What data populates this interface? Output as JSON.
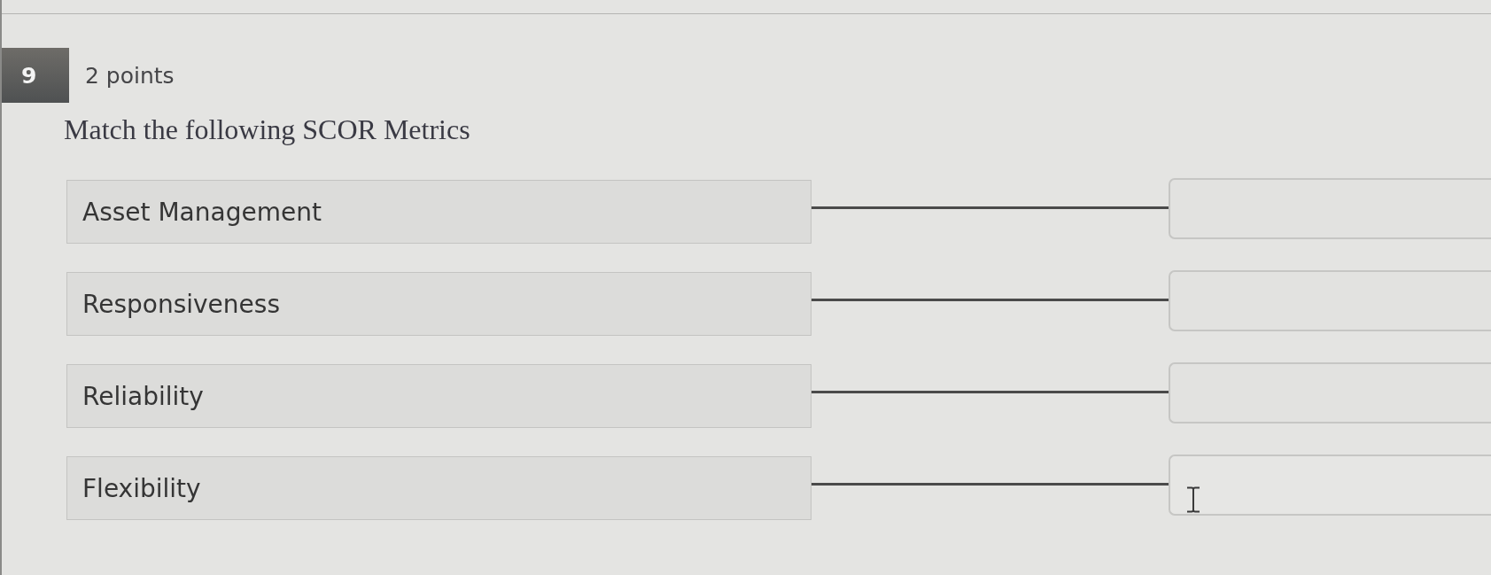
{
  "question": {
    "number": "9",
    "points": "2 points",
    "prompt": "Match the following SCOR Metrics"
  },
  "pairs": [
    {
      "prompt": "Asset Management",
      "answer_hovered": false
    },
    {
      "prompt": "Responsiveness",
      "answer_hovered": false
    },
    {
      "prompt": "Reliability",
      "answer_hovered": false
    },
    {
      "prompt": "Flexibility",
      "answer_hovered": true
    }
  ]
}
